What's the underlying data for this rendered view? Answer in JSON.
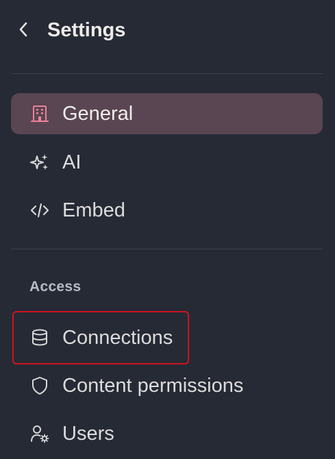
{
  "header": {
    "title": "Settings",
    "back_icon": "chevron-left-icon"
  },
  "nav": {
    "items": [
      {
        "label": "General",
        "icon": "building-icon",
        "active": true
      },
      {
        "label": "AI",
        "icon": "sparkles-icon",
        "active": false
      },
      {
        "label": "Embed",
        "icon": "code-icon",
        "active": false
      }
    ]
  },
  "access": {
    "section_label": "Access",
    "items": [
      {
        "label": "Connections",
        "icon": "database-icon",
        "highlighted": true
      },
      {
        "label": "Content permissions",
        "icon": "shield-icon"
      },
      {
        "label": "Users",
        "icon": "user-settings-icon"
      }
    ]
  },
  "colors": {
    "background": "#262a35",
    "active_item_bg": "#594652",
    "active_icon": "#f0809a",
    "highlight_border": "#d0141e",
    "text": "#dcdcdc",
    "section_label": "#b8bcc6"
  }
}
